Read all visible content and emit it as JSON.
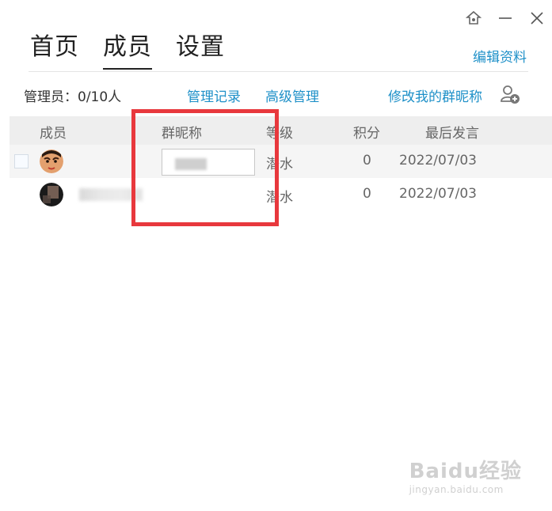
{
  "window": {
    "controls": [
      "pin-icon",
      "minimize-icon",
      "close-icon"
    ]
  },
  "tabs": [
    {
      "label": "首页",
      "active": false
    },
    {
      "label": "成员",
      "active": true
    },
    {
      "label": "设置",
      "active": false
    }
  ],
  "header": {
    "edit_profile": "编辑资料"
  },
  "toolbar": {
    "admins": "管理员：0/10人",
    "manage_log": "管理记录",
    "advanced_manage": "高级管理",
    "edit_nickname": "修改我的群昵称",
    "add_member_icon": "add-user-icon"
  },
  "table": {
    "headers": {
      "member": "成员",
      "nickname": "群昵称",
      "level": "等级",
      "points": "积分",
      "last_post": "最后发言"
    },
    "rows": [
      {
        "level": "潜水",
        "points": "0",
        "last_post": "2022/07/03"
      },
      {
        "level": "潜水",
        "points": "0",
        "last_post": "2022/07/03"
      }
    ]
  },
  "watermark": {
    "logo": "Baidu经验",
    "url": "jingyan.baidu.com"
  },
  "colors": {
    "link": "#1e90c8",
    "highlight": "#e8383d",
    "header_bg": "#eeeeee"
  }
}
